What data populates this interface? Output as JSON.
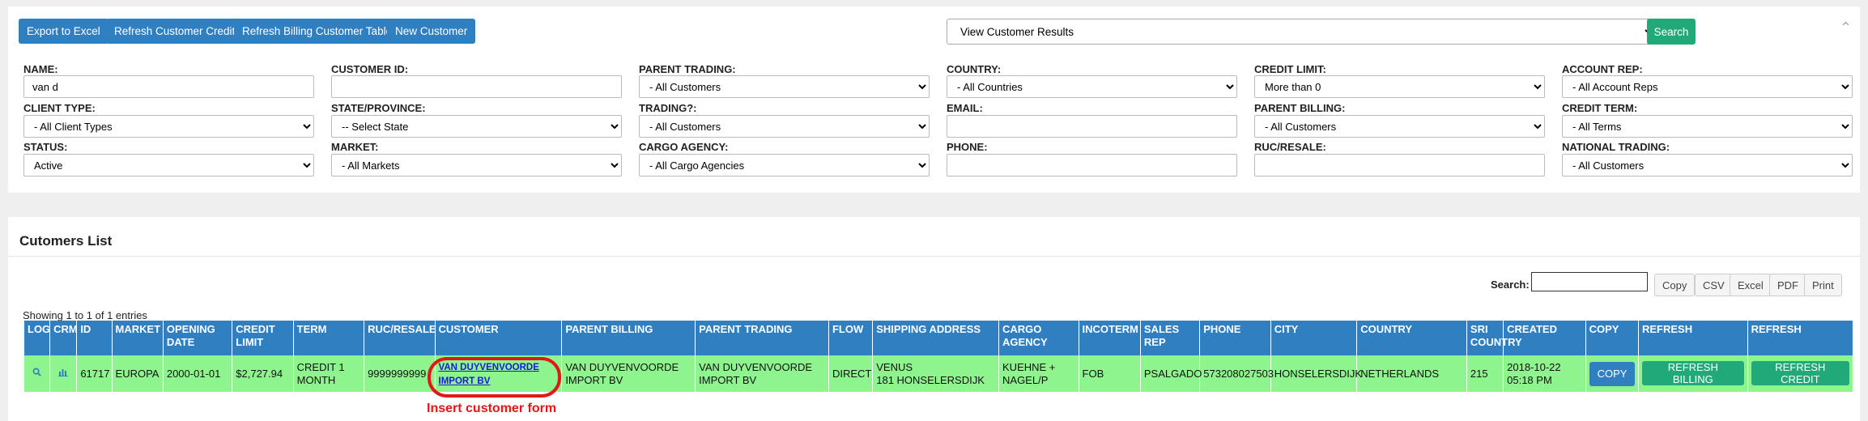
{
  "toolbar": {
    "export_excel": "Export to Excel",
    "refresh_credit": "Refresh Customer Credit",
    "refresh_billing_table": "Refresh Billing Customer Table",
    "new_customer": "New Customer",
    "view_select": "View Customer Results",
    "search": "Search"
  },
  "filters": {
    "name_label": "NAME:",
    "name_value": "van d",
    "customer_id_label": "CUSTOMER ID:",
    "customer_id_value": "",
    "parent_trading_label": "PARENT TRADING:",
    "parent_trading_value": "- All Customers",
    "country_label": "COUNTRY:",
    "country_value": "- All Countries",
    "credit_limit_label": "CREDIT LIMIT:",
    "credit_limit_value": "More than 0",
    "account_rep_label": "ACCOUNT REP:",
    "account_rep_value": "- All Account Reps",
    "client_type_label": "CLIENT TYPE:",
    "client_type_value": "- All Client Types",
    "state_label": "STATE/PROVINCE:",
    "state_value": "-- Select State",
    "trading_label": "TRADING?:",
    "trading_value": "- All Customers",
    "email_label": "EMAIL:",
    "email_value": "",
    "parent_billing_label": "PARENT BILLING:",
    "parent_billing_value": "- All Customers",
    "credit_term_label": "CREDIT TERM:",
    "credit_term_value": "- All Terms",
    "status_label": "STATUS:",
    "status_value": "Active",
    "market_label": "MARKET:",
    "market_value": "- All Markets",
    "cargo_agency_label": "CARGO AGENCY:",
    "cargo_agency_value": "- All Cargo Agencies",
    "phone_label": "PHONE:",
    "phone_value": "",
    "ruc_label": "RUC/RESALE:",
    "ruc_value": "",
    "national_trading_label": "NATIONAL TRADING:",
    "national_trading_value": "- All Customers"
  },
  "list": {
    "title": "Cutomers List",
    "search_label": "Search:",
    "buttons": {
      "copy": "Copy",
      "csv": "CSV",
      "excel": "Excel",
      "pdf": "PDF",
      "print": "Print"
    },
    "entries_text": "Showing 1 to 1 of 1 entries",
    "headers": [
      "LOG",
      "CRM",
      "ID",
      "MARKET",
      "OPENING DATE",
      "CREDIT LIMIT",
      "TERM",
      "RUC/RESALE",
      "CUSTOMER",
      "PARENT BILLING",
      "PARENT TRADING",
      "FLOW",
      "SHIPPING ADDRESS",
      "CARGO AGENCY",
      "INCOTERM",
      "SALES REP",
      "PHONE",
      "CITY",
      "COUNTRY",
      "SRI COUNTRY",
      "CREATED",
      "COPY",
      "REFRESH",
      "REFRESH"
    ],
    "row": {
      "id": "61717",
      "market": "EUROPA",
      "opening_date": "2000-01-01",
      "credit_limit": "$2,727.94",
      "term": "CREDIT 1 MONTH",
      "ruc": "9999999999",
      "customer": "VAN DUYVENVOORDE IMPORT BV",
      "parent_billing": "VAN DUYVENVOORDE IMPORT BV",
      "parent_trading": "VAN DUYVENVOORDE IMPORT BV",
      "flow": "DIRECT",
      "shipping_line1": "VENUS",
      "shipping_line2": "181 HONSELERSDIJK",
      "cargo_agency": "KUEHNE + NAGEL/P",
      "incoterm": "FOB",
      "sales_rep": "PSALGADO",
      "phone": "573208027503",
      "city": "HONSELERSDIJK",
      "country": "NETHERLANDS",
      "sri_country": "215",
      "created": "2018-10-22 05:18 PM",
      "copy_btn": "COPY",
      "refresh_billing_btn": "REFRESH BILLING",
      "refresh_credit_btn": "REFRESH CREDIT"
    }
  },
  "annotation": {
    "text": "Insert customer form",
    "color": "#e01818"
  },
  "colors": {
    "primary": "#2f7fc1",
    "success": "#22a97a",
    "row_highlight": "#8ef58e"
  }
}
